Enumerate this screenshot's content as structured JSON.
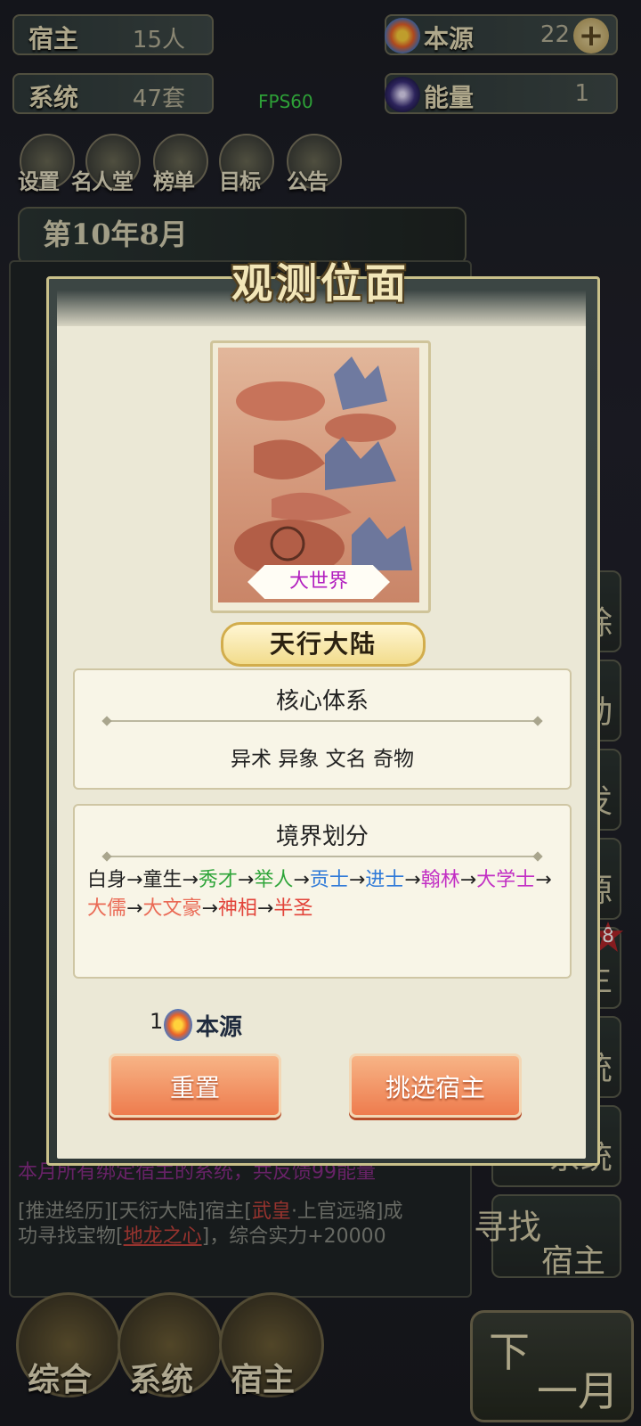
{
  "top_bar": {
    "host": {
      "label": "宿主",
      "value": "15人"
    },
    "origin": {
      "label": "本源",
      "value": "22"
    },
    "system": {
      "label": "系统",
      "value": "47套"
    },
    "energy": {
      "label": "能量",
      "value": "1"
    },
    "fps": "FPS60"
  },
  "menu": [
    "设置",
    "名人堂",
    "榜单",
    "目标",
    "公告"
  ],
  "date": "第10年8月",
  "log": {
    "bottom_purple": "本月所有绑定宿主的系统，共反馈99能量",
    "line1_a": "[推进经历][天衍大陆]宿主[",
    "line1_red": "武皇",
    "line1_b": "·上官远骆]成",
    "line2_a": "功寻找宝物[",
    "line2_red": "地龙之心",
    "line2_b": "]，综合实力+20000"
  },
  "side_buttons": {
    "b1": "除",
    "b2": "动",
    "b3": "发",
    "b4": "源",
    "b5": "主",
    "b5_badge": "8",
    "b6": "统",
    "b7": "系统",
    "b8_a": "寻找",
    "b8_b": "宿主"
  },
  "bottom_nav": {
    "n1": "综合",
    "n2": "系统",
    "n3": "宿主",
    "next_a": "下",
    "next_b": "一月"
  },
  "modal": {
    "title": "观测位面",
    "world_type": "大世界",
    "world_name": "天行大陆",
    "core_title": "核心体系",
    "core_text": "异术 异象 文名 奇物",
    "realm_title": "境界划分",
    "realm": [
      {
        "t": "白身",
        "c": "#222222"
      },
      {
        "t": "→",
        "c": "#222222"
      },
      {
        "t": "童生",
        "c": "#222222"
      },
      {
        "t": "→",
        "c": "#222222"
      },
      {
        "t": "秀才",
        "c": "#2fa53a"
      },
      {
        "t": "→",
        "c": "#222222"
      },
      {
        "t": "举人",
        "c": "#2fa53a"
      },
      {
        "t": "→",
        "c": "#222222"
      },
      {
        "t": "贡士",
        "c": "#2f7ad8"
      },
      {
        "t": "→",
        "c": "#222222"
      },
      {
        "t": "进士",
        "c": "#2f7ad8"
      },
      {
        "t": "→",
        "c": "#222222"
      },
      {
        "t": "翰林",
        "c": "#c22fc4"
      },
      {
        "t": "→",
        "c": "#222222"
      },
      {
        "t": "大学士",
        "c": "#c22fc4"
      },
      {
        "t": "→",
        "c": "#222222"
      },
      {
        "t": "大儒",
        "c": "#ea6a55"
      },
      {
        "t": "→",
        "c": "#222222"
      },
      {
        "t": "大文豪",
        "c": "#ea6a55"
      },
      {
        "t": "→",
        "c": "#222222"
      },
      {
        "t": "神相",
        "c": "#e2443a"
      },
      {
        "t": "→",
        "c": "#222222"
      },
      {
        "t": "半圣",
        "c": "#e2443a"
      }
    ],
    "cost_amount": "1",
    "cost_label": "本源",
    "reset_label": "重置",
    "select_label": "挑选宿主"
  }
}
